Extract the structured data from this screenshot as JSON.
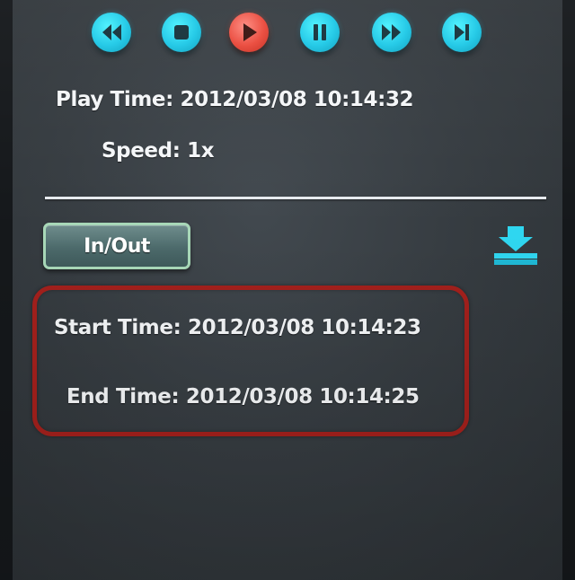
{
  "controls": {
    "items": [
      {
        "name": "rewind",
        "icon": "rewind-icon"
      },
      {
        "name": "stop",
        "icon": "stop-icon"
      },
      {
        "name": "play",
        "icon": "play-icon",
        "active": true
      },
      {
        "name": "pause",
        "icon": "pause-icon"
      },
      {
        "name": "fast-forward",
        "icon": "fast-forward-icon"
      },
      {
        "name": "step-forward",
        "icon": "step-forward-icon"
      }
    ],
    "accent_color": "#1fc8e6",
    "active_color": "#ea4a3c"
  },
  "playback": {
    "play_time": "Play Time: 2012/03/08 10:14:32",
    "speed": "Speed: 1x"
  },
  "clip": {
    "inout_label": "In/Out",
    "download_icon": "download-icon",
    "start_time": "Start Time: 2012/03/08 10:14:23",
    "end_time": "End Time: 2012/03/08 10:14:25",
    "highlight_color": "#a3201c"
  }
}
